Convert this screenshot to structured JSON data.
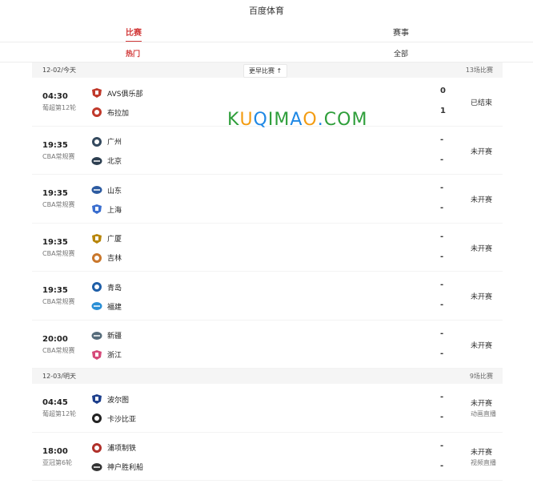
{
  "header": {
    "title": "百度体育"
  },
  "main_tabs": [
    {
      "label": "比赛"
    },
    {
      "label": "赛事"
    }
  ],
  "sub_tabs": [
    {
      "label": "热门"
    },
    {
      "label": "全部"
    }
  ],
  "watermark": {
    "letters": [
      "K",
      "U",
      "Q",
      "I",
      "M",
      "A",
      "O",
      ".",
      "C",
      "O",
      "M"
    ],
    "colors": [
      "#2e9e3a",
      "#f39c12",
      "#1e88e5",
      "#2e9e3a",
      "#2e9e3a",
      "#1e88e5",
      "#f39c12",
      "#1e88e5",
      "#2e9e3a",
      "#2e9e3a",
      "#2e9e3a"
    ]
  },
  "days": [
    {
      "date": "12-02/今天",
      "more": "更早比赛",
      "count": "13场比赛",
      "matches": [
        {
          "time": "04:30",
          "league": "葡超第12轮",
          "home": "AVS俱乐部",
          "away": "布拉加",
          "home_score": "0",
          "away_score": "1",
          "status": "已结束",
          "sub": ""
        },
        {
          "time": "19:35",
          "league": "CBA常规赛",
          "home": "广州",
          "away": "北京",
          "home_score": "-",
          "away_score": "-",
          "status": "未开赛",
          "sub": ""
        },
        {
          "time": "19:35",
          "league": "CBA常规赛",
          "home": "山东",
          "away": "上海",
          "home_score": "-",
          "away_score": "-",
          "status": "未开赛",
          "sub": ""
        },
        {
          "time": "19:35",
          "league": "CBA常规赛",
          "home": "广厦",
          "away": "吉林",
          "home_score": "-",
          "away_score": "-",
          "status": "未开赛",
          "sub": ""
        },
        {
          "time": "19:35",
          "league": "CBA常规赛",
          "home": "青岛",
          "away": "福建",
          "home_score": "-",
          "away_score": "-",
          "status": "未开赛",
          "sub": ""
        },
        {
          "time": "20:00",
          "league": "CBA常规赛",
          "home": "新疆",
          "away": "浙江",
          "home_score": "-",
          "away_score": "-",
          "status": "未开赛",
          "sub": ""
        }
      ]
    },
    {
      "date": "12-03/明天",
      "more": "",
      "count": "9场比赛",
      "matches": [
        {
          "time": "04:45",
          "league": "葡超第12轮",
          "home": "波尔图",
          "away": "卡沙比亚",
          "home_score": "-",
          "away_score": "-",
          "status": "未开赛",
          "sub": "动画直播"
        },
        {
          "time": "18:00",
          "league": "亚冠第6轮",
          "home": "浦项制铁",
          "away": "神户胜利船",
          "home_score": "-",
          "away_score": "-",
          "status": "未开赛",
          "sub": "视频直播"
        }
      ]
    }
  ],
  "logo_colors": {
    "AVS俱乐部": "#c0392b",
    "布拉加": "#c0392b",
    "广州": "#34495e",
    "北京": "#2c3e50",
    "山东": "#2c5aa0",
    "上海": "#3a6ecf",
    "广厦": "#b8860b",
    "吉林": "#c9772c",
    "青岛": "#1f5fa8",
    "福建": "#2a8fd6",
    "新疆": "#556b7a",
    "浙江": "#d64a7a",
    "波尔图": "#1d3f8c",
    "卡沙比亚": "#222222",
    "浦项制铁": "#b0302a",
    "神户胜利船": "#333333"
  }
}
